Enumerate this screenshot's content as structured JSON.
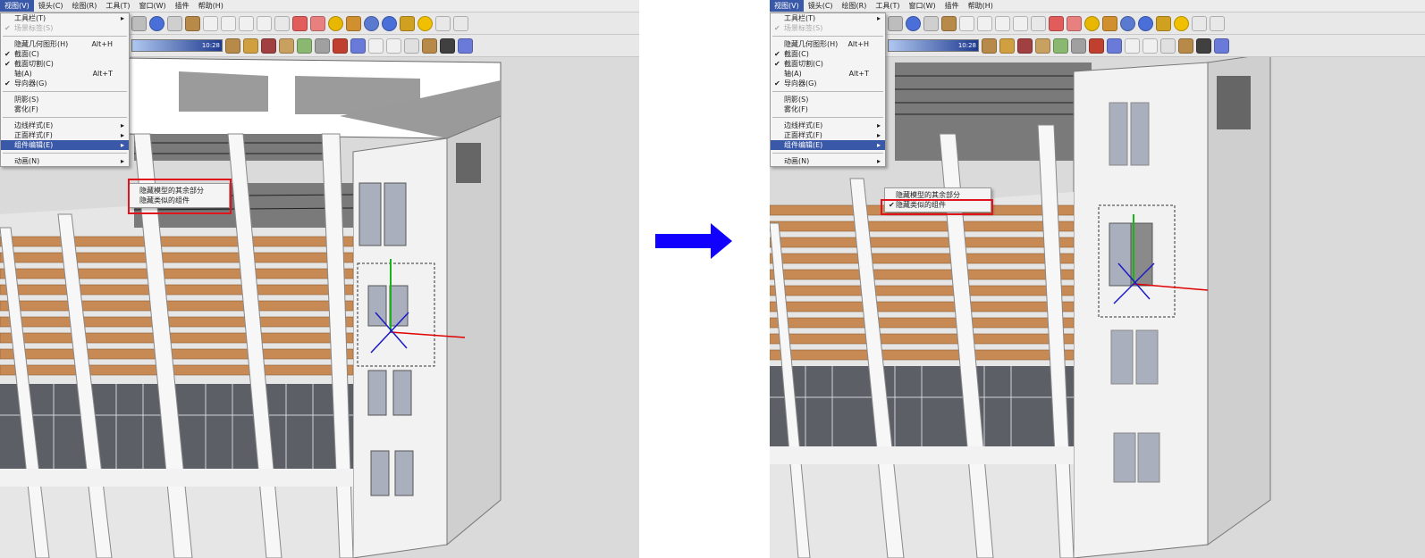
{
  "colors": {
    "highlight": "#3a58a8",
    "annotation": "#e0141c",
    "arrow": "#1200ff",
    "wood": "#c88a55",
    "wall": "#f2f2f2"
  },
  "menubar": [
    "视图(V)",
    "镜头(C)",
    "绘图(R)",
    "工具(T)",
    "窗口(W)",
    "插件",
    "帮助(H)"
  ],
  "toolbar": {
    "time_label": "10:28"
  },
  "view_menu": {
    "items": [
      {
        "label": "工具栏(T)",
        "arrow": "▸"
      },
      {
        "label": "场景标签(S)",
        "check": "✔",
        "disabled": true
      },
      {
        "sep": true
      },
      {
        "label": "隐藏几何图形(H)",
        "shortcut": "Alt+H"
      },
      {
        "label": "截面(C)",
        "check": "✔"
      },
      {
        "label": "截面切割(C)",
        "check": "✔"
      },
      {
        "label": "轴(A)",
        "shortcut": "Alt+T"
      },
      {
        "label": "导向器(G)",
        "check": "✔"
      },
      {
        "sep": true
      },
      {
        "label": "阴影(S)"
      },
      {
        "label": "雾化(F)"
      },
      {
        "sep": true
      },
      {
        "label": "边线样式(E)",
        "arrow": "▸"
      },
      {
        "label": "正面样式(F)",
        "arrow": "▸"
      },
      {
        "label": "组件编辑(E)",
        "arrow": "▸",
        "highlight": true
      },
      {
        "sep": true
      },
      {
        "label": "动画(N)",
        "arrow": "▸"
      }
    ]
  },
  "submenu": {
    "items": [
      "隐藏模型的其余部分",
      "隐藏类似的组件"
    ]
  },
  "right_submenu_checks": [
    "",
    "✔"
  ]
}
